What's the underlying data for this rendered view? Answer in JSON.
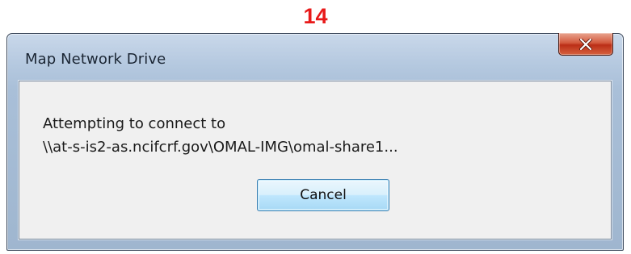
{
  "annotation": {
    "step_number": "14"
  },
  "dialog": {
    "title": "Map Network Drive",
    "message_line1": "Attempting to connect to",
    "message_line2": "\\\\at-s-is2-as.ncifcrf.gov\\OMAL-IMG\\omal-share1...",
    "cancel_label": "Cancel",
    "close_icon": "close-icon"
  },
  "colors": {
    "step_number": "#e81a1a",
    "close_button": "#c8402a",
    "cancel_border": "#3c7fb1"
  }
}
